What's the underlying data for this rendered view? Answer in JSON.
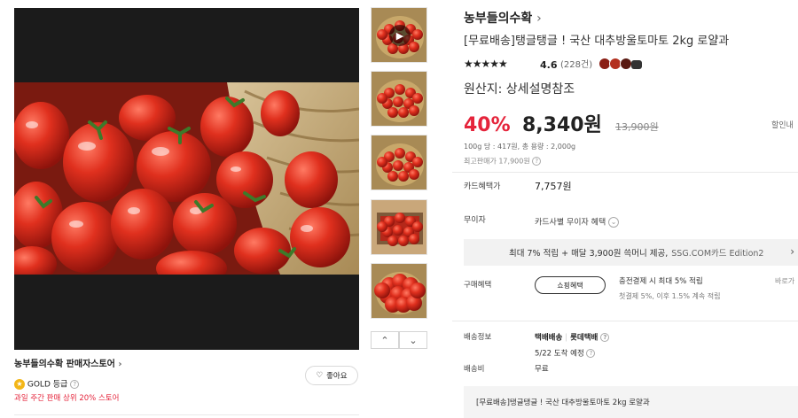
{
  "gallery": {
    "thumbs": [
      {
        "play": true
      },
      {
        "play": false
      },
      {
        "play": false
      },
      {
        "play": false
      },
      {
        "play": false
      }
    ],
    "prev_icon": "chevron-up",
    "next_icon": "chevron-down"
  },
  "seller": {
    "name": "농부들의수확 판매자스토어",
    "grade": "GOLD 등급",
    "rank_text": "과일 주간 판매 상위 20% 스토어",
    "like_label": "좋아요"
  },
  "product": {
    "brand": "농부들의수확",
    "title": "[무료배송]탱글탱글 ! 국산 대추방울토마토 2kg 로얄과",
    "rating": "4.6",
    "review_count": "(228건)",
    "origin": "원산지: 상세설명참조",
    "discount": "40%",
    "price": "8,340원",
    "original_price": "13,900원",
    "coupon_link": "할인내",
    "unit_info": "100g 당 : 417원, 총 용량 : 2,000g",
    "max_price": "최고판매가 17,900원"
  },
  "benefits": {
    "card_label": "카드혜택가",
    "card_price": "7,757원",
    "installment_label": "무이자",
    "installment_value": "카드사별 무이자 혜택",
    "banner": "최대 7% 적립 + 매달 3,900원 쓱머니 제공,",
    "banner_card": "SSG.COM카드 Edition2",
    "purchase_label": "구매혜택",
    "shopping_button": "쇼핑혜택",
    "charge_title": "충전결제 시 최대 5% 적립",
    "charge_detail": "첫결제 5%, 이후 1.5% 계속 적립",
    "right_link": "바로가"
  },
  "delivery": {
    "label": "배송정보",
    "method1": "택배배송",
    "method2": "롯데택배",
    "eta": "5/22 도착 예정",
    "fee_label": "배송비",
    "fee": "무료"
  },
  "option_box": {
    "text": "[무료배송]탱글탱글 ! 국산 대추방울토마토 2kg 로얄과"
  },
  "colors": {
    "accent": "#e5243b",
    "muted": "#888888",
    "text": "#222222"
  }
}
